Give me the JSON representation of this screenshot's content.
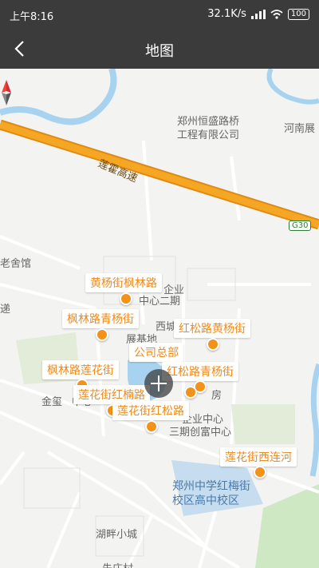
{
  "status": {
    "time": "上午8:16",
    "network_speed": "32.1K/s",
    "battery": "100"
  },
  "header": {
    "title": "地图"
  },
  "map": {
    "labels": {
      "company_a": "郑州恒盛路桥",
      "company_b": "工程有限公司",
      "henan": "河南展",
      "expressway": "莲霍高速",
      "g30": "G30",
      "museum": "老舍馆",
      "edge_di": "递",
      "center2": "中心二期",
      "xicheng": "西城",
      "zhanjidi": "展基地",
      "qiye": "企业",
      "jinxi": "金玺",
      "zhongxin": "中心",
      "fang": "房",
      "qiye_center": "企业中心",
      "chuangfu": "三期创富中心",
      "school_a": "郑州中学红梅街",
      "school_b": "校区高中校区",
      "hupan": "湖畔小城",
      "zhuang": "朱庄村"
    },
    "pois": [
      {
        "name": "黄杨街枫林路"
      },
      {
        "name": "枫林路青杨街"
      },
      {
        "name": "红松路黄杨街"
      },
      {
        "name": "公司总部"
      },
      {
        "name": "枫林路莲花街"
      },
      {
        "name": "红松路青杨街"
      },
      {
        "name": "莲花街红楠路"
      },
      {
        "name": "莲花街红松路"
      },
      {
        "name": "莲花街西连河"
      }
    ],
    "colors": {
      "road_highway": "#f5a623",
      "water": "#a8d3f0",
      "poi": "#f29219",
      "green": "#cfe8c4"
    }
  }
}
